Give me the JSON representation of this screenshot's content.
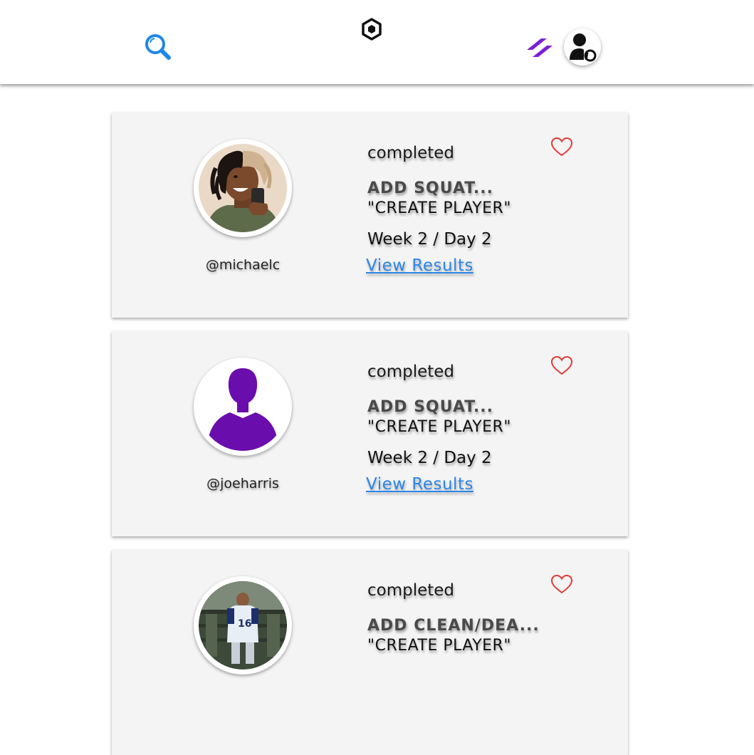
{
  "header": {
    "search_icon": "search-icon",
    "logo_icon": "hexagon-logo-icon",
    "program_icon": "double-slash-icon",
    "profile_icon": "user-profile-icon",
    "colors": {
      "search": "#1e88e5",
      "program": "#7b1fd8",
      "logo": "#111111"
    }
  },
  "feed": {
    "posts": [
      {
        "username": "@michaelc",
        "status": "completed",
        "exercise": "ADD SQUAT...",
        "program": "\"CREATE PLAYER\"",
        "schedule": "Week 2  /  Day 2",
        "link_label": "View Results",
        "avatar_type": "cartoon-photo"
      },
      {
        "username": "@joeharris",
        "status": "completed",
        "exercise": "ADD SQUAT...",
        "program": "\"CREATE PLAYER\"",
        "schedule": "Week 2  /  Day 2",
        "link_label": "View Results",
        "avatar_type": "default-silhouette"
      },
      {
        "username": "",
        "status": "completed",
        "exercise": "ADD CLEAN/DEA...",
        "program": "\"CREATE PLAYER\"",
        "schedule": "",
        "link_label": "",
        "avatar_type": "football-photo"
      }
    ],
    "like_icon": "heart-outline-icon",
    "colors": {
      "link": "#2b86e8",
      "like": "#e53935",
      "silhouette": "#6a0dad",
      "card_bg": "#f4f4f4"
    }
  }
}
